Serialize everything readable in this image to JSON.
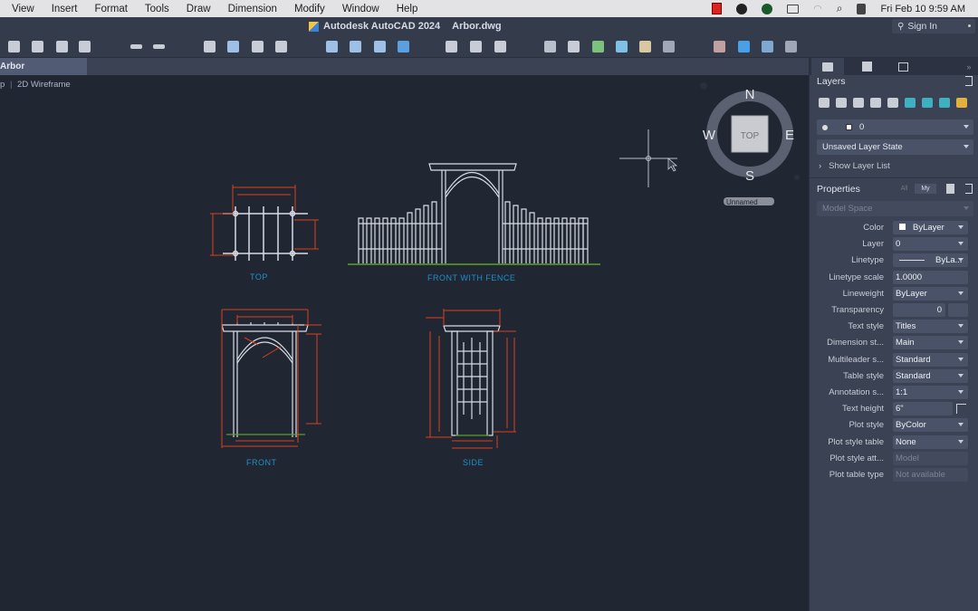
{
  "menubar": {
    "items": [
      "View",
      "Insert",
      "Format",
      "Tools",
      "Draw",
      "Dimension",
      "Modify",
      "Window",
      "Help"
    ],
    "clock": "Fri Feb 10  9:59 AM"
  },
  "titlebar": {
    "app": "Autodesk AutoCAD 2024",
    "file": "Arbor.dwg",
    "signin": "Sign In"
  },
  "toolbar": {
    "icons": [
      "new-icon",
      "open-icon",
      "save-icon",
      "save-as-icon",
      "undo-icon",
      "redo-icon",
      "plot-icon",
      "batch-plot-icon",
      "page-setup-icon",
      "publish-icon",
      "import-icon",
      "export-icon",
      "attach-icon",
      "share-icon",
      "zoom-window-icon",
      "pan-icon",
      "orbit-icon",
      "layer-state-icon",
      "match-properties-icon",
      "quick-select-icon",
      "block-icon",
      "insert-icon",
      "xref-icon",
      "sheet-set-icon",
      "send-icon",
      "viewports-icon",
      "layout-icon"
    ]
  },
  "document_tab": {
    "label": "Arbor"
  },
  "viewport": {
    "label_view": "p",
    "label_style": "2D Wireframe",
    "viewcube": {
      "top": "TOP",
      "north": "N",
      "south": "S",
      "east": "E",
      "west": "W",
      "ucs": "Unnamed"
    },
    "drawings": {
      "top": "TOP",
      "front_fence": "FRONT WITH FENCE",
      "front": "FRONT",
      "side": "SIDE"
    }
  },
  "layers_panel": {
    "title": "Layers",
    "current_layer": "0",
    "layer_state": "Unsaved Layer State",
    "show_list": "Show Layer List"
  },
  "properties_panel": {
    "title": "Properties",
    "toggle_all": "All",
    "toggle_my": "My",
    "context": "Model Space",
    "rows": [
      {
        "label": "Color",
        "value": "ByLayer",
        "type": "dropdown"
      },
      {
        "label": "Layer",
        "value": "0",
        "type": "dropdown"
      },
      {
        "label": "Linetype",
        "value": "ByLa...",
        "type": "dropdown"
      },
      {
        "label": "Linetype scale",
        "value": "1.0000",
        "type": "input"
      },
      {
        "label": "Lineweight",
        "value": "ByLayer",
        "type": "dropdown"
      },
      {
        "label": "Transparency",
        "value": "0",
        "type": "input"
      },
      {
        "label": "Text style",
        "value": "Titles",
        "type": "dropdown"
      },
      {
        "label": "Dimension st...",
        "value": "Main",
        "type": "dropdown"
      },
      {
        "label": "Multileader s...",
        "value": "Standard",
        "type": "dropdown"
      },
      {
        "label": "Table style",
        "value": "Standard",
        "type": "dropdown"
      },
      {
        "label": "Annotation s...",
        "value": "1:1",
        "type": "dropdown"
      },
      {
        "label": "Text height",
        "value": "6\"",
        "type": "input"
      },
      {
        "label": "Plot style",
        "value": "ByColor",
        "type": "dropdown"
      },
      {
        "label": "Plot style table",
        "value": "None",
        "type": "dropdown"
      },
      {
        "label": "Plot style att...",
        "value": "Model",
        "type": "disabled"
      },
      {
        "label": "Plot table type",
        "value": "Not available",
        "type": "disabled"
      }
    ]
  },
  "colors": {
    "accent_label": "#1e90c8",
    "dimension": "#d9401c",
    "geometry": "#d8dce4",
    "ground": "#5aa02c"
  }
}
